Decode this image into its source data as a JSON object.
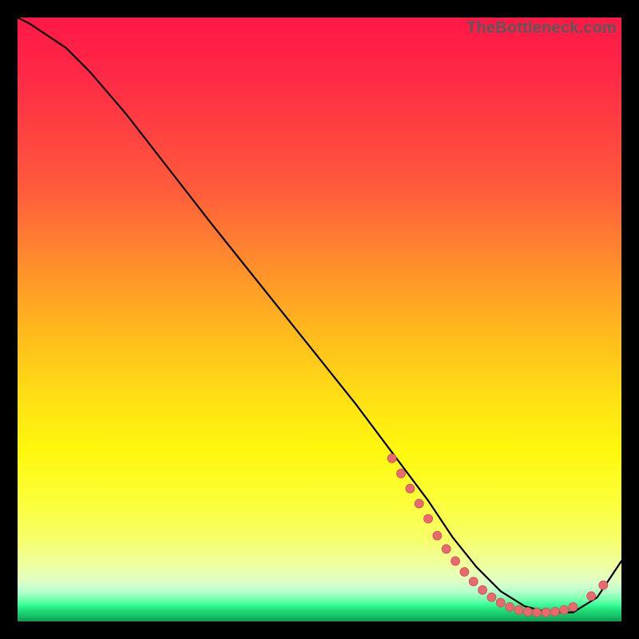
{
  "watermark": "TheBottleneck.com",
  "colors": {
    "curve_stroke": "#000000",
    "marker_fill": "#e86a6f",
    "marker_stroke": "#d14e55",
    "background_black": "#000000"
  },
  "chart_data": {
    "type": "line",
    "title": "",
    "xlabel": "",
    "ylabel": "",
    "xlim": [
      0,
      100
    ],
    "ylim": [
      0,
      100
    ],
    "grid": false,
    "legend": false,
    "series": [
      {
        "name": "bottleneck-curve",
        "x": [
          0,
          2,
          5,
          8,
          12,
          18,
          25,
          32,
          40,
          48,
          56,
          62,
          68,
          72,
          76,
          80,
          84,
          88,
          92,
          96,
          100
        ],
        "values": [
          100,
          99,
          97,
          95,
          91,
          84,
          75,
          66,
          56,
          46,
          36,
          28,
          20,
          14,
          9,
          5,
          2.5,
          1.5,
          1.5,
          4,
          10
        ]
      }
    ],
    "markers": [
      {
        "x": 62.0,
        "y": 27.0
      },
      {
        "x": 63.5,
        "y": 24.5
      },
      {
        "x": 65.0,
        "y": 22.0
      },
      {
        "x": 66.5,
        "y": 19.5
      },
      {
        "x": 68.0,
        "y": 17.0
      },
      {
        "x": 69.5,
        "y": 14.2
      },
      {
        "x": 71.0,
        "y": 12.0
      },
      {
        "x": 72.5,
        "y": 10.0
      },
      {
        "x": 74.0,
        "y": 8.2
      },
      {
        "x": 75.5,
        "y": 6.6
      },
      {
        "x": 77.0,
        "y": 5.2
      },
      {
        "x": 78.5,
        "y": 4.0
      },
      {
        "x": 80.0,
        "y": 3.1
      },
      {
        "x": 81.5,
        "y": 2.4
      },
      {
        "x": 83.0,
        "y": 1.9
      },
      {
        "x": 84.5,
        "y": 1.6
      },
      {
        "x": 86.0,
        "y": 1.5
      },
      {
        "x": 87.5,
        "y": 1.5
      },
      {
        "x": 89.0,
        "y": 1.6
      },
      {
        "x": 90.5,
        "y": 1.9
      },
      {
        "x": 92.0,
        "y": 2.4
      },
      {
        "x": 95.0,
        "y": 4.2
      },
      {
        "x": 97.0,
        "y": 6.0
      }
    ]
  }
}
